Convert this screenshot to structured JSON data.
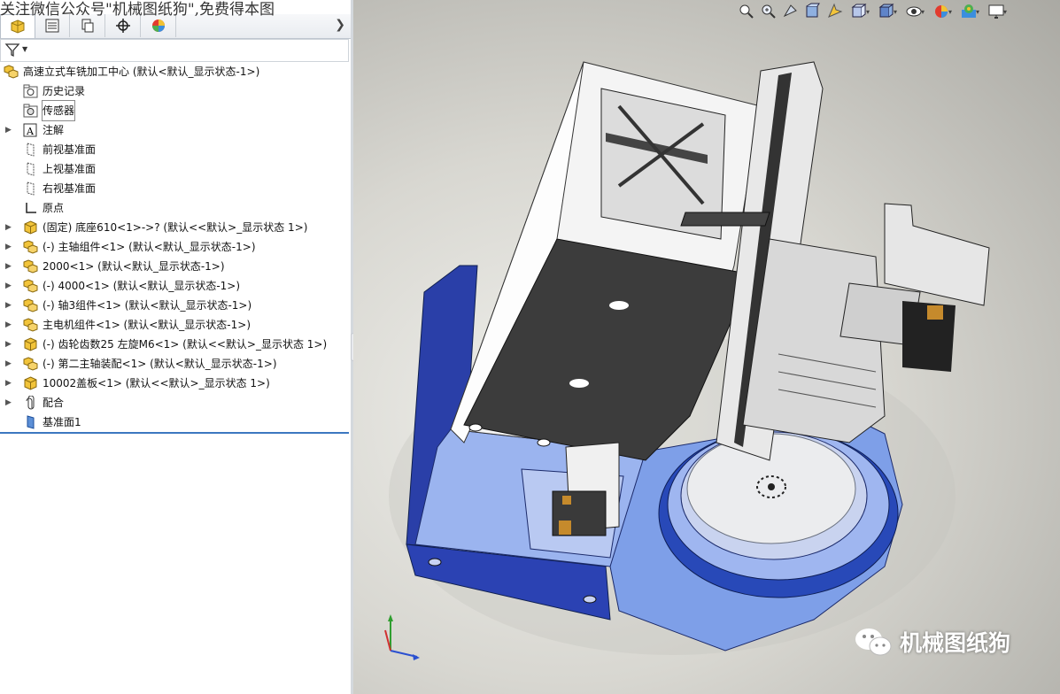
{
  "watermark_top": "关注微信公众号\"机械图纸狗\",免费得本图",
  "watermark_bottom": "机械图纸狗",
  "panel_tabs": [
    {
      "icon": "feature-manager-icon"
    },
    {
      "icon": "property-manager-icon"
    },
    {
      "icon": "configuration-manager-icon"
    },
    {
      "icon": "dimxpert-icon"
    },
    {
      "icon": "display-manager-icon"
    }
  ],
  "tree": {
    "root": "高速立式车铣加工中心  (默认<默认_显示状态-1>)",
    "items": [
      {
        "label": "历史记录",
        "icon": "history-folder-icon",
        "expand": false
      },
      {
        "label": "传感器",
        "icon": "sensor-folder-icon",
        "expand": false,
        "selected": true
      },
      {
        "label": "注解",
        "icon": "annotation-icon",
        "expand": true
      },
      {
        "label": "前视基准面",
        "icon": "plane-icon",
        "expand": false
      },
      {
        "label": "上视基准面",
        "icon": "plane-icon",
        "expand": false
      },
      {
        "label": "右视基准面",
        "icon": "plane-icon",
        "expand": false
      },
      {
        "label": "原点",
        "icon": "origin-icon",
        "expand": false
      },
      {
        "label": "(固定) 底座610<1>->? (默认<<默认>_显示状态 1>)",
        "icon": "part-icon",
        "expand": true
      },
      {
        "label": "(-) 主轴组件<1> (默认<默认_显示状态-1>)",
        "icon": "assembly-icon",
        "expand": true
      },
      {
        "label": "2000<1> (默认<默认_显示状态-1>)",
        "icon": "assembly-icon",
        "expand": true
      },
      {
        "label": "(-) 4000<1> (默认<默认_显示状态-1>)",
        "icon": "assembly-icon",
        "expand": true
      },
      {
        "label": "(-) 轴3组件<1> (默认<默认_显示状态-1>)",
        "icon": "assembly-icon",
        "expand": true
      },
      {
        "label": "主电机组件<1> (默认<默认_显示状态-1>)",
        "icon": "assembly-icon",
        "expand": true
      },
      {
        "label": "(-) 齿轮齿数25  左旋M6<1> (默认<<默认>_显示状态 1>)",
        "icon": "part-icon",
        "expand": true
      },
      {
        "label": "(-) 第二主轴装配<1> (默认<默认_显示状态-1>)",
        "icon": "assembly-icon",
        "expand": true
      },
      {
        "label": "10002盖板<1> (默认<<默认>_显示状态 1>)",
        "icon": "part-icon",
        "expand": true
      },
      {
        "label": "配合",
        "icon": "mates-icon",
        "expand": true
      },
      {
        "label": "基准面1",
        "icon": "plane-blue-icon",
        "expand": false
      }
    ]
  },
  "viewport_toolbar": [
    {
      "icon": "zoom-to-fit-icon"
    },
    {
      "icon": "zoom-to-area-icon"
    },
    {
      "icon": "previous-view-icon"
    },
    {
      "icon": "section-view-icon"
    },
    {
      "icon": "dynamic-annotation-icon"
    },
    {
      "icon": "view-orientation-icon",
      "dropdown": true
    },
    {
      "icon": "display-style-icon",
      "dropdown": true
    },
    {
      "icon": "hide-show-items-icon",
      "dropdown": true
    },
    {
      "icon": "edit-appearance-icon",
      "dropdown": true
    },
    {
      "icon": "apply-scene-icon",
      "dropdown": true
    },
    {
      "icon": "view-settings-icon",
      "dropdown": true
    }
  ]
}
